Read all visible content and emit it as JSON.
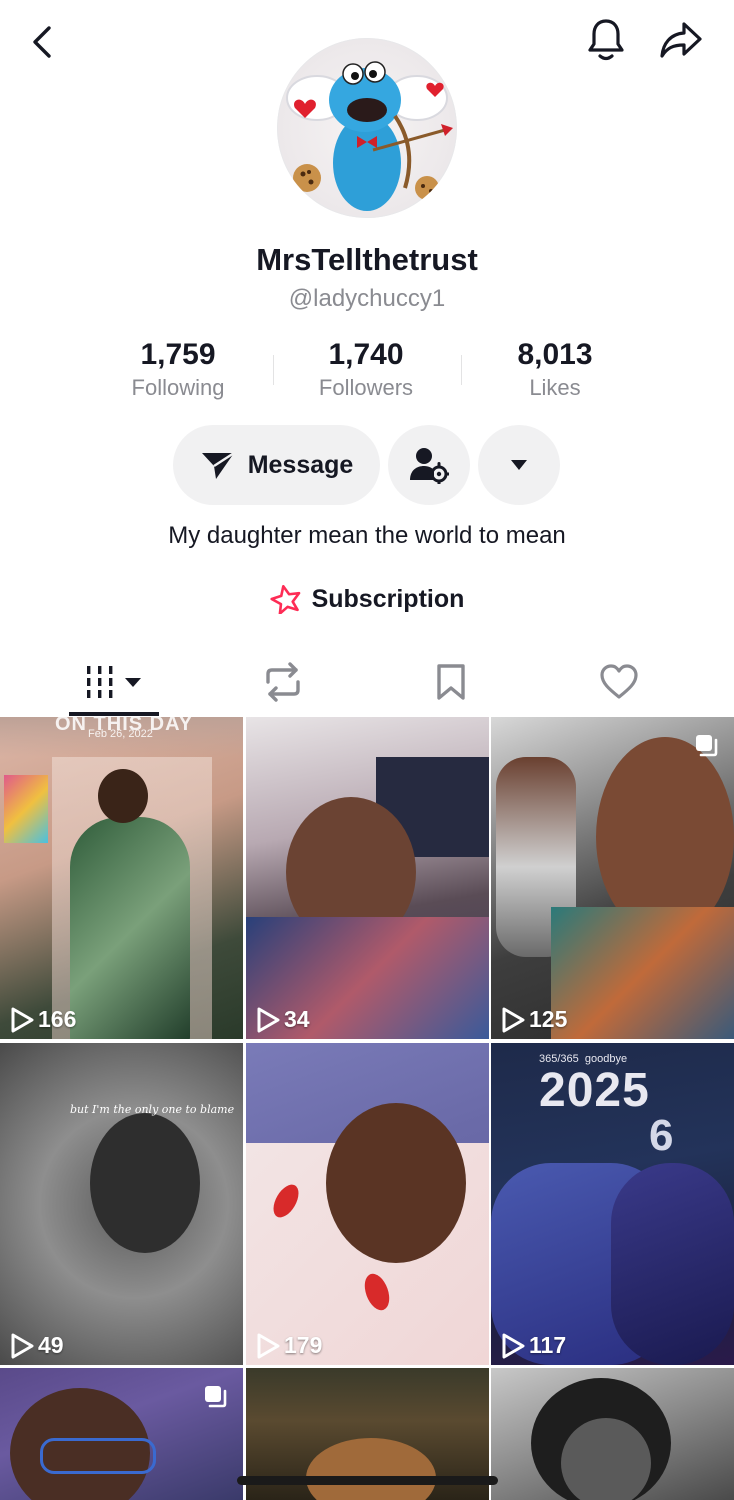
{
  "profile": {
    "display_name": "MrsTellthetrust",
    "username": "@ladychuccy1",
    "bio": "My daughter mean the world to mean"
  },
  "stats": [
    {
      "value": "1,759",
      "label": "Following"
    },
    {
      "value": "1,740",
      "label": "Followers"
    },
    {
      "value": "8,013",
      "label": "Likes"
    }
  ],
  "actions": {
    "message_label": "Message",
    "subscription_label": "Subscription"
  },
  "icons": {
    "back": "chevron-left-icon",
    "notifications": "bell-icon",
    "share": "share-arrow-icon",
    "add_friend": "person-gear-icon",
    "more": "caret-down-icon",
    "subscription": "star-icon",
    "videos_tab": "grid-bars-icon",
    "reposts_tab": "repost-icon",
    "saved_tab": "bookmark-icon",
    "liked_tab": "heart-icon",
    "play": "play-icon"
  },
  "colors": {
    "text": "#161823",
    "muted": "#8a8b91",
    "pill_bg": "#f1f1f2",
    "subscription_accent": "#fe2c55"
  },
  "videos": [
    {
      "views": "166",
      "overlay_text": "Feb 26, 2022",
      "caption_top": "ON THIS DAY",
      "multi": false
    },
    {
      "views": "34",
      "overlay_text": "",
      "caption_top": "",
      "multi": false
    },
    {
      "views": "125",
      "overlay_text": "",
      "caption_top": "",
      "multi": true
    },
    {
      "views": "49",
      "overlay_text": "but I'm the only one to blame",
      "caption_top": "",
      "multi": false
    },
    {
      "views": "179",
      "overlay_text": "",
      "caption_top": "",
      "multi": false
    },
    {
      "views": "117",
      "overlay_text": "365/365  goodbye",
      "caption_top": "2025",
      "caption_extra": "6",
      "multi": false
    },
    {
      "views": "",
      "overlay_text": "",
      "caption_top": "",
      "multi": true
    },
    {
      "views": "",
      "overlay_text": "",
      "caption_top": "",
      "multi": false
    },
    {
      "views": "",
      "overlay_text": "",
      "caption_top": "",
      "multi": false
    }
  ]
}
